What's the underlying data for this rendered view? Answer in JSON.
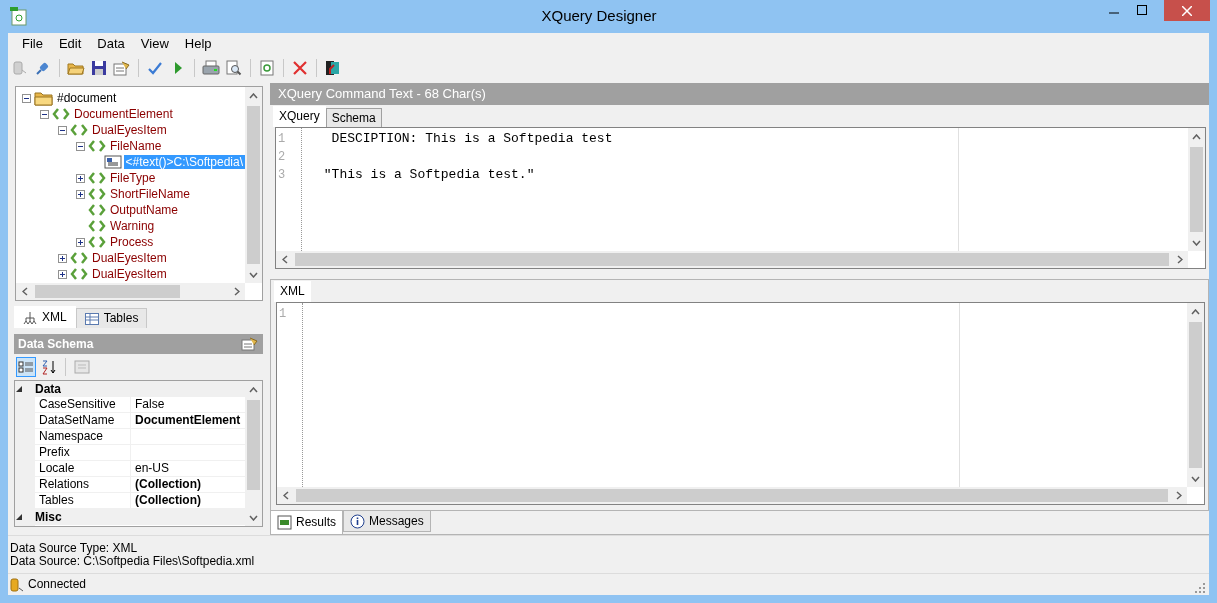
{
  "window": {
    "title": "XQuery Designer"
  },
  "menu": [
    "File",
    "Edit",
    "Data",
    "View",
    "Help"
  ],
  "tree": [
    {
      "label": "#document",
      "kind": "folder",
      "expanded": true,
      "selected": false,
      "children": [
        {
          "label": "DocumentElement",
          "kind": "element",
          "expanded": true,
          "selected": false,
          "children": [
            {
              "label": "DualEyesItem",
              "kind": "element",
              "expanded": true,
              "selected": false,
              "children": [
                {
                  "label": "FileName",
                  "kind": "element",
                  "expanded": true,
                  "selected": false,
                  "children": [
                    {
                      "label": "<#text()>C:\\Softpedia\\",
                      "kind": "text",
                      "selected": true
                    }
                  ]
                },
                {
                  "label": "FileType",
                  "kind": "element",
                  "expanded": false,
                  "selected": false
                },
                {
                  "label": "ShortFileName",
                  "kind": "element",
                  "expanded": false,
                  "selected": false
                },
                {
                  "label": "OutputName",
                  "kind": "element",
                  "selected": false
                },
                {
                  "label": "Warning",
                  "kind": "element",
                  "selected": false
                },
                {
                  "label": "Process",
                  "kind": "element",
                  "expanded": false,
                  "selected": false
                }
              ]
            },
            {
              "label": "DualEyesItem",
              "kind": "element",
              "expanded": false,
              "selected": false
            },
            {
              "label": "DualEyesItem",
              "kind": "element",
              "expanded": false,
              "selected": false
            }
          ]
        }
      ]
    }
  ],
  "left_tabs": [
    {
      "label": "XML",
      "kind": "tree",
      "selected": true
    },
    {
      "label": "Tables",
      "kind": "table",
      "selected": false
    }
  ],
  "schema": {
    "title": "Data Schema",
    "categories": [
      {
        "name": "Data",
        "rows": [
          {
            "name": "CaseSensitive",
            "value": "False",
            "is_default": true
          },
          {
            "name": "DataSetName",
            "value": "DocumentElement",
            "is_default": false
          },
          {
            "name": "Namespace"
          },
          {
            "name": "Prefix"
          },
          {
            "name": "Locale",
            "value": "en-US",
            "is_default": true
          },
          {
            "name": "Relations",
            "value": "(Collection)",
            "is_default": false
          },
          {
            "name": "Tables",
            "value": "(Collection)",
            "is_default": false
          }
        ]
      },
      {
        "name": "Misc"
      }
    ]
  },
  "query": {
    "header": "XQuery Command Text - 68 Char(s)",
    "tabs": [
      {
        "label": "XQuery",
        "selected": true
      },
      {
        "label": "Schema",
        "selected": false
      }
    ],
    "lines": [
      {
        "number": "1",
        "text": "  DESCIPTION: This is a Softpedia test"
      },
      {
        "number": "2"
      },
      {
        "number": "3",
        "text": " \"This is a Softpedia test.\""
      }
    ]
  },
  "xml": {
    "tabs": [
      {
        "label": "XML",
        "selected": true
      }
    ],
    "lines": [
      {
        "number": "1"
      }
    ]
  },
  "result_tabs": [
    {
      "label": "Results",
      "kind": "results",
      "selected": true
    },
    {
      "label": "Messages",
      "kind": "info",
      "selected": false
    }
  ],
  "info": [
    "Data Source Type: XML",
    "Data Source: C:\\Softpedia Files\\Softpedia.xml"
  ],
  "status_bar": {
    "text": "Connected"
  }
}
